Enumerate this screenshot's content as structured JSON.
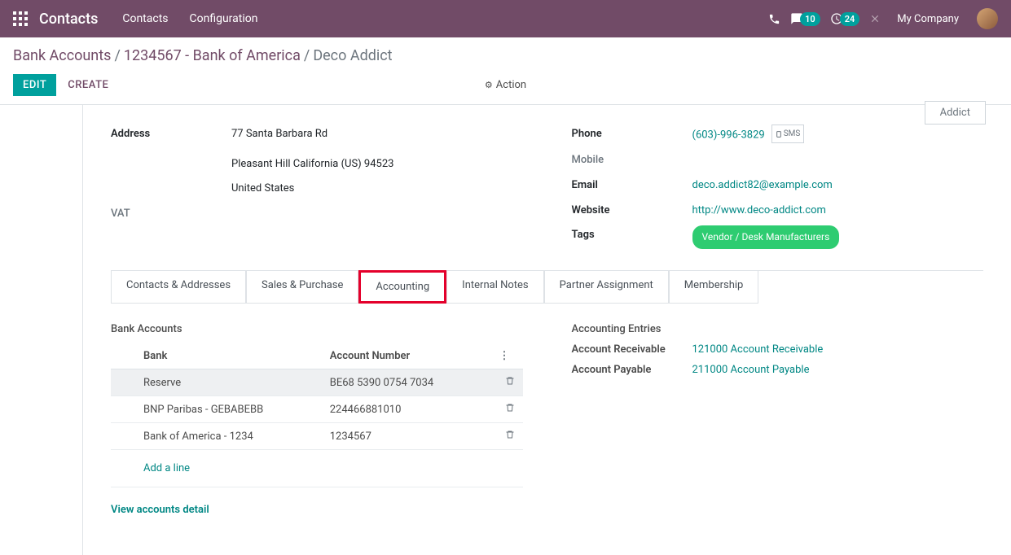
{
  "topbar": {
    "app_title": "Contacts",
    "nav": {
      "contacts": "Contacts",
      "configuration": "Configuration"
    },
    "msg_badge": "10",
    "activity_badge": "24",
    "company": "My Company"
  },
  "breadcrumb": {
    "level1": "Bank Accounts",
    "level2": "1234567 - Bank of America",
    "current": "Deco Addict"
  },
  "buttons": {
    "edit": "EDIT",
    "create": "CREATE",
    "action": "Action"
  },
  "stat_button": "Addict",
  "address": {
    "label": "Address",
    "street": "77 Santa Barbara Rd",
    "city_line": "Pleasant Hill  California (US)  94523",
    "country": "United States"
  },
  "vat_label": "VAT",
  "contact": {
    "phone_label": "Phone",
    "phone": "(603)-996-3829",
    "sms": "SMS",
    "mobile_label": "Mobile",
    "email_label": "Email",
    "email": "deco.addict82@example.com",
    "website_label": "Website",
    "website": "http://www.deco-addict.com",
    "tags_label": "Tags",
    "tag": "Vendor / Desk Manufacturers"
  },
  "tabs": {
    "contacts": "Contacts & Addresses",
    "sales": "Sales & Purchase",
    "accounting": "Accounting",
    "notes": "Internal Notes",
    "partner": "Partner Assignment",
    "membership": "Membership"
  },
  "bank_section": {
    "title": "Bank Accounts",
    "col_bank": "Bank",
    "col_number": "Account Number",
    "rows": [
      {
        "bank": "Reserve",
        "number": "BE68 5390 0754 7034"
      },
      {
        "bank": "BNP Paribas - GEBABEBB",
        "number": "224466881010"
      },
      {
        "bank": "Bank of America - 1234",
        "number": "1234567"
      }
    ],
    "add_line": "Add a line",
    "view_detail": "View accounts detail"
  },
  "entries_section": {
    "title": "Accounting Entries",
    "receivable_label": "Account Receivable",
    "receivable_value": "121000 Account Receivable",
    "payable_label": "Account Payable",
    "payable_value": "211000 Account Payable"
  }
}
